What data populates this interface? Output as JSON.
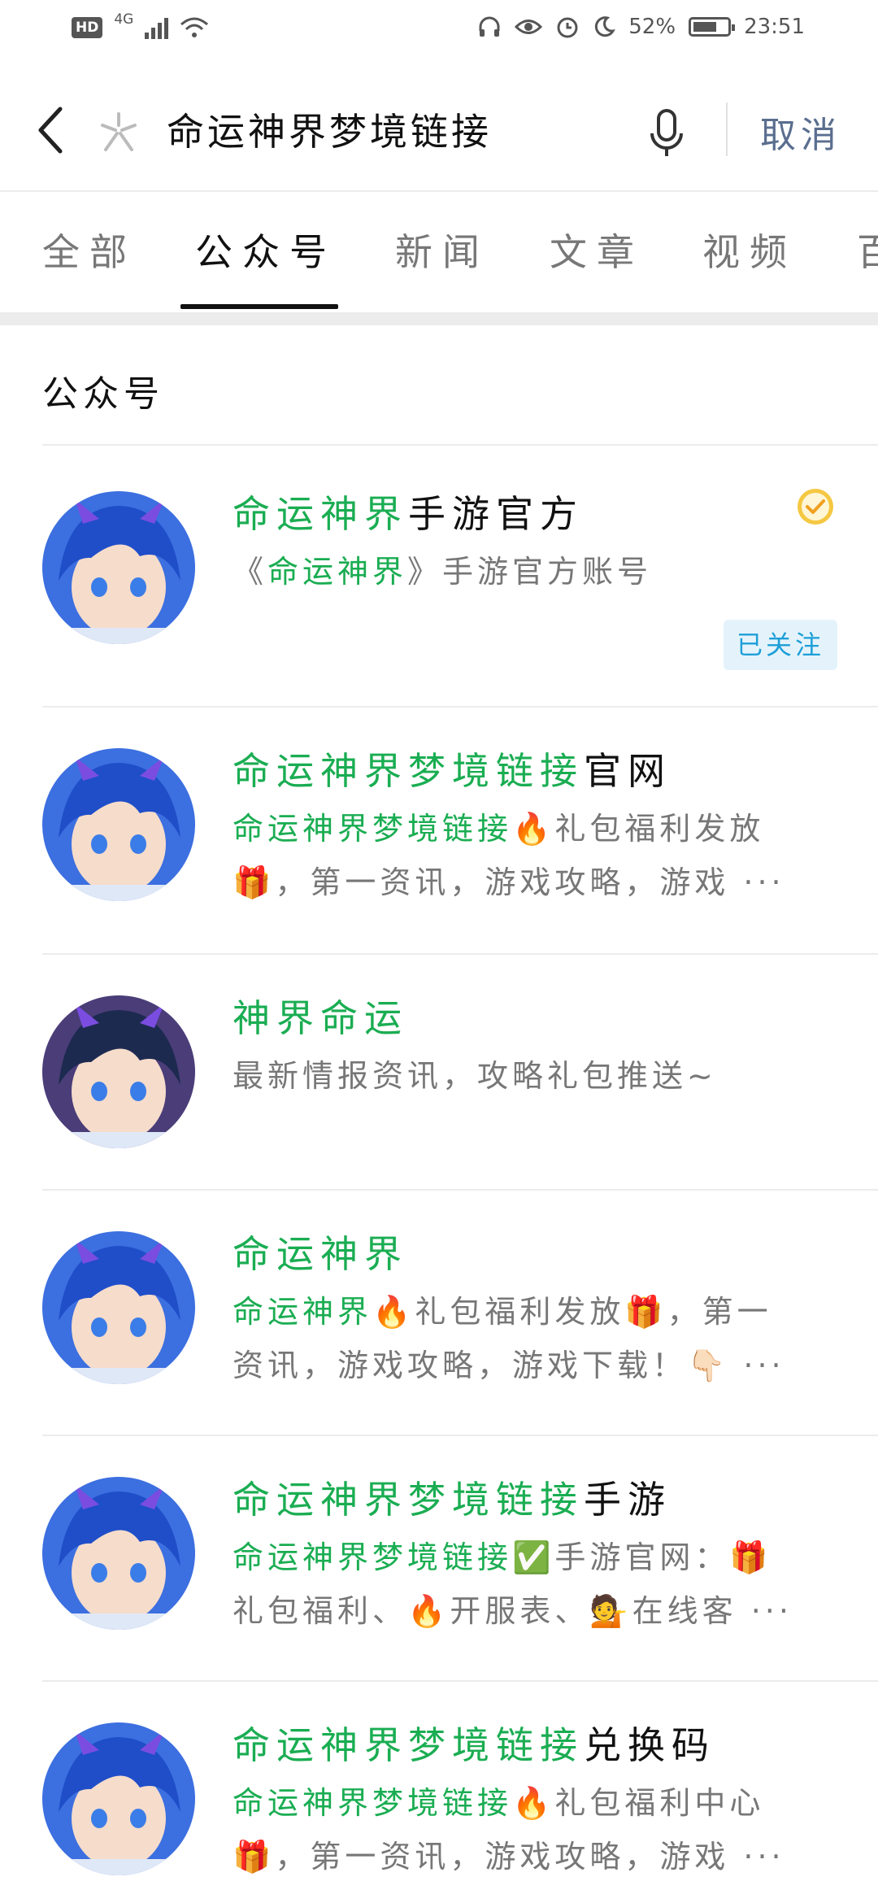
{
  "status_bar": {
    "left": {
      "hd": "HD",
      "network": "4G"
    },
    "right": {
      "battery": "52%",
      "time": "23:51"
    }
  },
  "search": {
    "query": "命运神界梦境链接",
    "cancel_label": "取消"
  },
  "tabs": [
    {
      "label": "全部"
    },
    {
      "label": "公众号",
      "active": true
    },
    {
      "label": "新闻"
    },
    {
      "label": "文章"
    },
    {
      "label": "视频"
    },
    {
      "label": "百"
    }
  ],
  "section_title": "公众号",
  "results": [
    {
      "title_hl": "命运神界",
      "title_rest": "手游官方",
      "desc_lines": [
        [
          {
            "t": "《"
          },
          {
            "t": "命运神界",
            "hl": true
          },
          {
            "t": "》手游官方账号"
          }
        ]
      ],
      "verified": true,
      "follow_label": "已关注"
    },
    {
      "title_hl": "命运神界梦境链接",
      "title_rest": "官网",
      "desc_lines": [
        [
          {
            "t": "命运神界梦境链接",
            "hl": true
          },
          {
            "t": "🔥礼包福利发放"
          }
        ],
        [
          {
            "t": "🎁，第一资讯，游戏攻略，游戏 ···"
          }
        ]
      ]
    },
    {
      "title_hl": "神界命运",
      "title_rest": "",
      "desc_lines": [
        [
          {
            "t": "最新情报资讯，攻略礼包推送~"
          }
        ]
      ]
    },
    {
      "title_hl": "命运神界",
      "title_rest": "",
      "desc_lines": [
        [
          {
            "t": "命运神界",
            "hl": true
          },
          {
            "t": "🔥礼包福利发放🎁，第一"
          }
        ],
        [
          {
            "t": "资讯，游戏攻略，游戏下载！👇🏻 ···"
          }
        ]
      ]
    },
    {
      "title_hl": "命运神界梦境链接",
      "title_rest": "手游",
      "desc_lines": [
        [
          {
            "t": "命运神界梦境链接",
            "hl": true
          },
          {
            "t": "✅手游官网：🎁"
          }
        ],
        [
          {
            "t": "礼包福利、🔥开服表、💁在线客 ···"
          }
        ]
      ]
    },
    {
      "title_hl": "命运神界梦境链接",
      "title_rest": "兑换码",
      "desc_lines": [
        [
          {
            "t": "命运神界梦境链接",
            "hl": true
          },
          {
            "t": "🔥礼包福利中心"
          }
        ],
        [
          {
            "t": "🎁，第一资讯，游戏攻略，游戏 ···"
          }
        ]
      ]
    }
  ],
  "colors": {
    "highlight": "#1aad52",
    "cancel": "#5a6e8f",
    "follow": "#1e9fd8"
  }
}
